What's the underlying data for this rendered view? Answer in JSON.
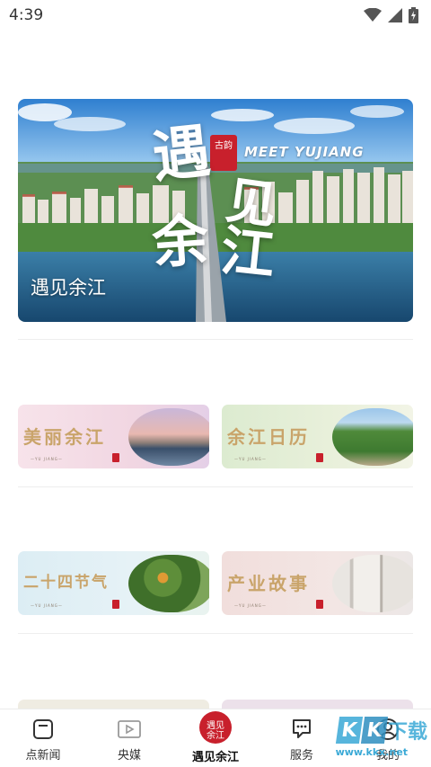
{
  "status_bar": {
    "time": "4:39",
    "icons": [
      "wifi-icon",
      "signal-icon",
      "battery-charging-icon"
    ]
  },
  "hero": {
    "label": "遇见余江",
    "badge": "古韵",
    "english": "MEET YUJIANG",
    "calligraphy": [
      "遇",
      "见",
      "余",
      "江"
    ]
  },
  "cards": [
    {
      "title": "美丽余江",
      "sub": "—YU JIANG—",
      "theme": "pink"
    },
    {
      "title": "余江日历",
      "sub": "—YU JIANG—",
      "theme": "green"
    },
    {
      "title": "二十四节气",
      "sub": "—YU JIANG—",
      "theme": "blue"
    },
    {
      "title": "产业故事",
      "sub": "—YU JIANG—",
      "theme": "rose"
    }
  ],
  "bottom_nav": {
    "items": [
      {
        "label": "点新闻",
        "icon": "news-icon",
        "active": false
      },
      {
        "label": "央媒",
        "icon": "video-icon",
        "active": false
      },
      {
        "label": "遇见余江",
        "icon": "meet-yujiang-logo-icon",
        "active": true,
        "logo_text": "遇见余江"
      },
      {
        "label": "服务",
        "icon": "service-chat-icon",
        "active": false
      },
      {
        "label": "我的",
        "icon": "profile-icon",
        "active": false
      }
    ]
  },
  "watermark": {
    "letters": [
      "K",
      "K"
    ],
    "cn": "下载",
    "url": "www.kkx.net"
  },
  "colors": {
    "accent": "#c8202c",
    "divider": "#eeeeee",
    "watermark": "#3aa9d6"
  }
}
